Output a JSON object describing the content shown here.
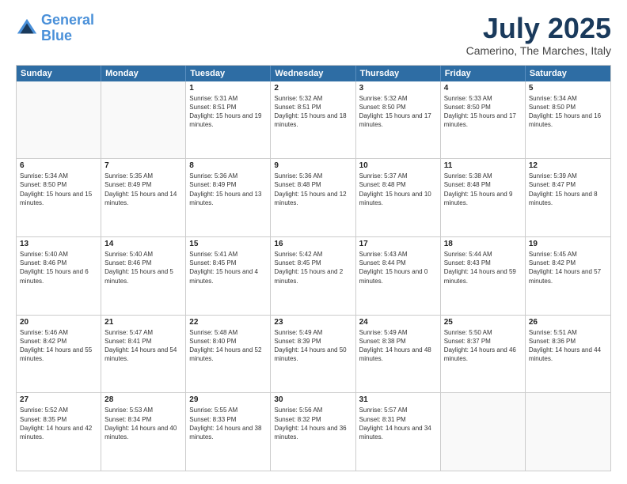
{
  "logo": {
    "line1": "General",
    "line2": "Blue"
  },
  "title": "July 2025",
  "subtitle": "Camerino, The Marches, Italy",
  "header_days": [
    "Sunday",
    "Monday",
    "Tuesday",
    "Wednesday",
    "Thursday",
    "Friday",
    "Saturday"
  ],
  "weeks": [
    [
      {
        "day": "",
        "info": ""
      },
      {
        "day": "",
        "info": ""
      },
      {
        "day": "1",
        "info": "Sunrise: 5:31 AM\nSunset: 8:51 PM\nDaylight: 15 hours and 19 minutes."
      },
      {
        "day": "2",
        "info": "Sunrise: 5:32 AM\nSunset: 8:51 PM\nDaylight: 15 hours and 18 minutes."
      },
      {
        "day": "3",
        "info": "Sunrise: 5:32 AM\nSunset: 8:50 PM\nDaylight: 15 hours and 17 minutes."
      },
      {
        "day": "4",
        "info": "Sunrise: 5:33 AM\nSunset: 8:50 PM\nDaylight: 15 hours and 17 minutes."
      },
      {
        "day": "5",
        "info": "Sunrise: 5:34 AM\nSunset: 8:50 PM\nDaylight: 15 hours and 16 minutes."
      }
    ],
    [
      {
        "day": "6",
        "info": "Sunrise: 5:34 AM\nSunset: 8:50 PM\nDaylight: 15 hours and 15 minutes."
      },
      {
        "day": "7",
        "info": "Sunrise: 5:35 AM\nSunset: 8:49 PM\nDaylight: 15 hours and 14 minutes."
      },
      {
        "day": "8",
        "info": "Sunrise: 5:36 AM\nSunset: 8:49 PM\nDaylight: 15 hours and 13 minutes."
      },
      {
        "day": "9",
        "info": "Sunrise: 5:36 AM\nSunset: 8:48 PM\nDaylight: 15 hours and 12 minutes."
      },
      {
        "day": "10",
        "info": "Sunrise: 5:37 AM\nSunset: 8:48 PM\nDaylight: 15 hours and 10 minutes."
      },
      {
        "day": "11",
        "info": "Sunrise: 5:38 AM\nSunset: 8:48 PM\nDaylight: 15 hours and 9 minutes."
      },
      {
        "day": "12",
        "info": "Sunrise: 5:39 AM\nSunset: 8:47 PM\nDaylight: 15 hours and 8 minutes."
      }
    ],
    [
      {
        "day": "13",
        "info": "Sunrise: 5:40 AM\nSunset: 8:46 PM\nDaylight: 15 hours and 6 minutes."
      },
      {
        "day": "14",
        "info": "Sunrise: 5:40 AM\nSunset: 8:46 PM\nDaylight: 15 hours and 5 minutes."
      },
      {
        "day": "15",
        "info": "Sunrise: 5:41 AM\nSunset: 8:45 PM\nDaylight: 15 hours and 4 minutes."
      },
      {
        "day": "16",
        "info": "Sunrise: 5:42 AM\nSunset: 8:45 PM\nDaylight: 15 hours and 2 minutes."
      },
      {
        "day": "17",
        "info": "Sunrise: 5:43 AM\nSunset: 8:44 PM\nDaylight: 15 hours and 0 minutes."
      },
      {
        "day": "18",
        "info": "Sunrise: 5:44 AM\nSunset: 8:43 PM\nDaylight: 14 hours and 59 minutes."
      },
      {
        "day": "19",
        "info": "Sunrise: 5:45 AM\nSunset: 8:42 PM\nDaylight: 14 hours and 57 minutes."
      }
    ],
    [
      {
        "day": "20",
        "info": "Sunrise: 5:46 AM\nSunset: 8:42 PM\nDaylight: 14 hours and 55 minutes."
      },
      {
        "day": "21",
        "info": "Sunrise: 5:47 AM\nSunset: 8:41 PM\nDaylight: 14 hours and 54 minutes."
      },
      {
        "day": "22",
        "info": "Sunrise: 5:48 AM\nSunset: 8:40 PM\nDaylight: 14 hours and 52 minutes."
      },
      {
        "day": "23",
        "info": "Sunrise: 5:49 AM\nSunset: 8:39 PM\nDaylight: 14 hours and 50 minutes."
      },
      {
        "day": "24",
        "info": "Sunrise: 5:49 AM\nSunset: 8:38 PM\nDaylight: 14 hours and 48 minutes."
      },
      {
        "day": "25",
        "info": "Sunrise: 5:50 AM\nSunset: 8:37 PM\nDaylight: 14 hours and 46 minutes."
      },
      {
        "day": "26",
        "info": "Sunrise: 5:51 AM\nSunset: 8:36 PM\nDaylight: 14 hours and 44 minutes."
      }
    ],
    [
      {
        "day": "27",
        "info": "Sunrise: 5:52 AM\nSunset: 8:35 PM\nDaylight: 14 hours and 42 minutes."
      },
      {
        "day": "28",
        "info": "Sunrise: 5:53 AM\nSunset: 8:34 PM\nDaylight: 14 hours and 40 minutes."
      },
      {
        "day": "29",
        "info": "Sunrise: 5:55 AM\nSunset: 8:33 PM\nDaylight: 14 hours and 38 minutes."
      },
      {
        "day": "30",
        "info": "Sunrise: 5:56 AM\nSunset: 8:32 PM\nDaylight: 14 hours and 36 minutes."
      },
      {
        "day": "31",
        "info": "Sunrise: 5:57 AM\nSunset: 8:31 PM\nDaylight: 14 hours and 34 minutes."
      },
      {
        "day": "",
        "info": ""
      },
      {
        "day": "",
        "info": ""
      }
    ]
  ]
}
